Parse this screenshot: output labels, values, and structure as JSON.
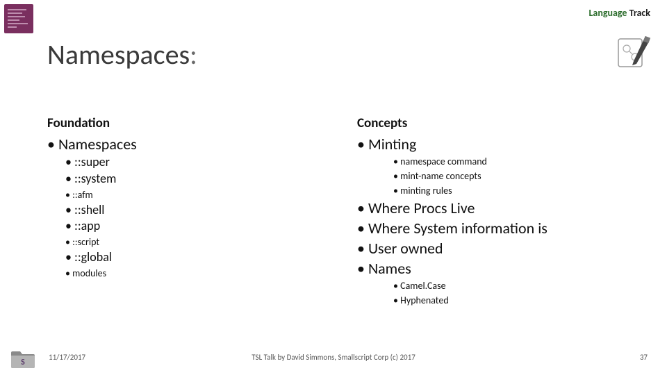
{
  "track": {
    "language": "Language",
    "track": "Track"
  },
  "title": {
    "text": "Namespaces",
    "colon": ":"
  },
  "left": {
    "heading": "Foundation",
    "root": "Namespaces",
    "items_a": [
      "::super",
      "::system"
    ],
    "sub_a": [
      "::afm"
    ],
    "items_b": [
      "::shell",
      "::app"
    ],
    "sub_b": [
      "::script"
    ],
    "items_c": [
      "::global"
    ],
    "sub_c": [
      "modules"
    ]
  },
  "right": {
    "heading": "Concepts",
    "root": "Minting",
    "minting_sub": [
      "namespace command",
      "mint-name concepts",
      "minting rules"
    ],
    "rest": [
      "Where Procs Live",
      "Where System information is",
      "User owned",
      "Names"
    ],
    "names_sub": [
      "Camel.Case",
      "Hyphenated"
    ]
  },
  "footer": {
    "date": "11/17/2017",
    "mid": "TSL Talk by David Simmons, Smallscript Corp (c) 2017",
    "page": "37"
  }
}
